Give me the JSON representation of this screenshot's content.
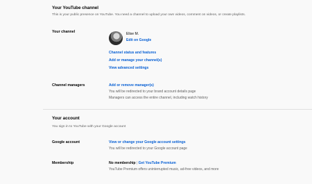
{
  "channel_section": {
    "title": "Your YouTube channel",
    "subtitle": "This is your public presence on YouTube. You need a channel to upload your own videos, comment on videos, or create playlists.",
    "your_channel_label": "Your channel",
    "user_name": "Elise M.",
    "edit_link": "Edit on Google",
    "links": [
      "Channel status and features",
      "Add or manage your channel(s)",
      "View advanced settings"
    ],
    "managers_label": "Channel managers",
    "managers_link": "Add or remove manager(s)",
    "managers_note_1": "You will be redirected to your brand account details page",
    "managers_note_2": "Managers can access the entire channel, including watch history"
  },
  "account_section": {
    "title": "Your account",
    "subtitle": "You sign in to YouTube with your Google account",
    "google_label": "Google account",
    "google_link": "View or change your Google account settings",
    "google_note": "You will be redirected to your Google account page",
    "membership_label": "Membership",
    "membership_status": "No membership",
    "membership_sep": "|",
    "membership_link": "Get YouTube Premium",
    "membership_note": "YouTube Premium offers uninterrupted music, ad-free videos, and more"
  }
}
